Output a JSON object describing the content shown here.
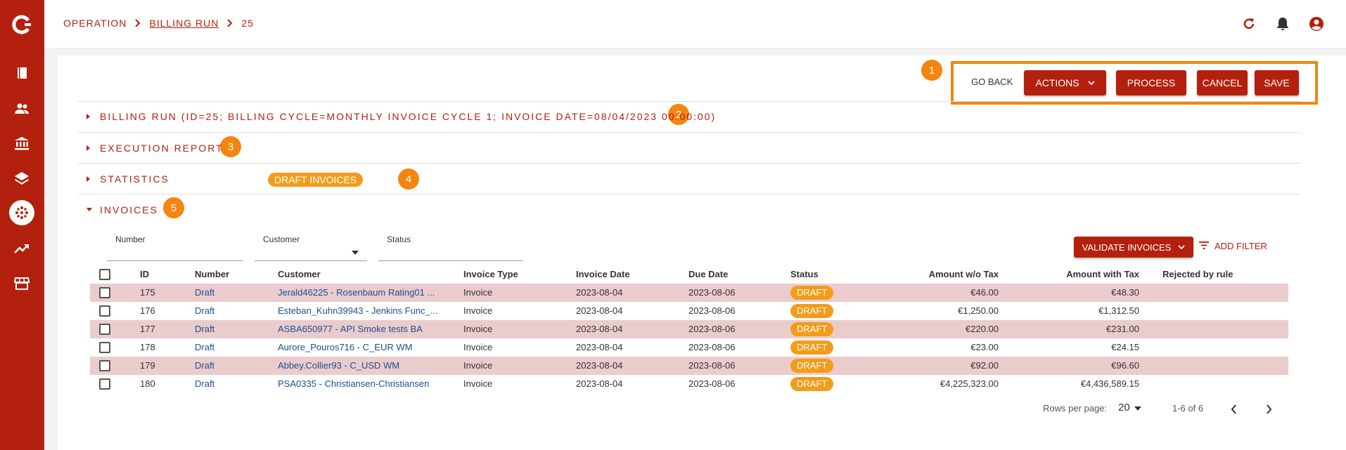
{
  "breadcrumb": {
    "root": "OPERATION",
    "section": "BILLING RUN",
    "current": "25"
  },
  "actions": {
    "go_back": "GO BACK",
    "actions": "ACTIONS",
    "process": "PROCESS",
    "cancel": "CANCEL",
    "save": "SAVE"
  },
  "badges": [
    "1",
    "2",
    "3",
    "4",
    "5"
  ],
  "sections": {
    "billing_run": "BILLING RUN (ID=25; BILLING CYCLE=MONTHLY INVOICE CYCLE 1; INVOICE DATE=08/04/2023 00:00:00)",
    "execution_report": "EXECUTION REPORT",
    "statistics": "STATISTICS",
    "draft_invoices_chip": "DRAFT INVOICES",
    "invoices": "INVOICES"
  },
  "filters": {
    "number_label": "Number",
    "customer_label": "Customer",
    "status_label": "Status",
    "validate_button": "VALIDATE INVOICES",
    "add_filter": "ADD FILTER"
  },
  "table": {
    "headers": {
      "id": "ID",
      "number": "Number",
      "customer": "Customer",
      "invoice_type": "Invoice Type",
      "invoice_date": "Invoice Date",
      "due_date": "Due Date",
      "status": "Status",
      "amount_wo_tax": "Amount w/o Tax",
      "amount_with_tax": "Amount with Tax",
      "rejected_by_rule": "Rejected by rule"
    },
    "rows": [
      {
        "id": "175",
        "number": "Draft",
        "customer": "Jerald46225 - Rosenbaum Rating01 ...",
        "invoice_type": "Invoice",
        "invoice_date": "2023-08-04",
        "due_date": "2023-08-06",
        "status": "DRAFT",
        "amount_wo_tax": "€46.00",
        "amount_with_tax": "€48.30",
        "rejected_by_rule": ""
      },
      {
        "id": "176",
        "number": "Draft",
        "customer": "Esteban_Kuhn39943 - Jenkins Func_...",
        "invoice_type": "Invoice",
        "invoice_date": "2023-08-04",
        "due_date": "2023-08-06",
        "status": "DRAFT",
        "amount_wo_tax": "€1,250.00",
        "amount_with_tax": "€1,312.50",
        "rejected_by_rule": ""
      },
      {
        "id": "177",
        "number": "Draft",
        "customer": "ASBA650977 - API Smoke tests BA",
        "invoice_type": "Invoice",
        "invoice_date": "2023-08-04",
        "due_date": "2023-08-06",
        "status": "DRAFT",
        "amount_wo_tax": "€220.00",
        "amount_with_tax": "€231.00",
        "rejected_by_rule": ""
      },
      {
        "id": "178",
        "number": "Draft",
        "customer": "Aurore_Pouros716 - C_EUR WM",
        "invoice_type": "Invoice",
        "invoice_date": "2023-08-04",
        "due_date": "2023-08-06",
        "status": "DRAFT",
        "amount_wo_tax": "€23.00",
        "amount_with_tax": "€24.15",
        "rejected_by_rule": ""
      },
      {
        "id": "179",
        "number": "Draft",
        "customer": "Abbey.Collier93 - C_USD WM",
        "invoice_type": "Invoice",
        "invoice_date": "2023-08-04",
        "due_date": "2023-08-06",
        "status": "DRAFT",
        "amount_wo_tax": "€92.00",
        "amount_with_tax": "€96.60",
        "rejected_by_rule": ""
      },
      {
        "id": "180",
        "number": "Draft",
        "customer": "PSA0335 - Christiansen-Christiansen",
        "invoice_type": "Invoice",
        "invoice_date": "2023-08-04",
        "due_date": "2023-08-06",
        "status": "DRAFT",
        "amount_wo_tax": "€4,225,323.00",
        "amount_with_tax": "€4,436,589.15",
        "rejected_by_rule": ""
      }
    ]
  },
  "pagination": {
    "rows_per_page_label": "Rows per page:",
    "rows_per_page": "20",
    "range": "1-6 of 6"
  },
  "colors": {
    "brand": "#b3200e",
    "accent": "#f4850f",
    "chip": "#f39c1a",
    "row_shade": "#ebcccc"
  },
  "icons": {
    "sidebar": [
      "logo-icon",
      "book-icon",
      "people-icon",
      "bank-icon",
      "layers-icon",
      "dots-circle-icon",
      "trending-up-icon",
      "store-icon"
    ],
    "topbar": [
      "refresh-icon",
      "bell-icon",
      "account-icon"
    ]
  }
}
